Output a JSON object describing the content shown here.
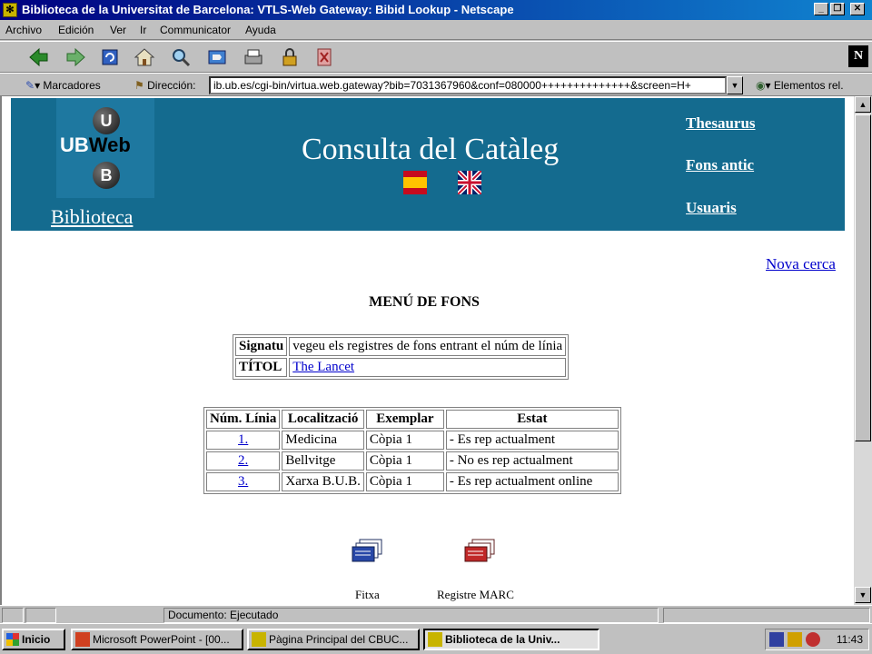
{
  "window": {
    "title": "Biblioteca de la Universitat de Barcelona: VTLS-Web Gateway: Bibid Lookup - Netscape"
  },
  "menu": [
    "Archivo",
    "Edición",
    "Ver",
    "Ir",
    "Communicator",
    "Ayuda"
  ],
  "location_bar": {
    "bookmarks_label": "Marcadores",
    "address_label": "Dirección:",
    "url": "ib.ub.es/cgi-bin/virtua.web.gateway?bib=7031367960&conf=080000++++++++++++++&screen=H+",
    "related_label": "Elementos rel."
  },
  "banner": {
    "logo_u": "U",
    "logo_word_ub": "UB",
    "logo_word_web": "Web",
    "logo_b": "B",
    "biblioteca": "Biblioteca",
    "title": "Consulta del Catàleg",
    "links": [
      "Thesaurus",
      "Fons antic",
      "Usuaris"
    ]
  },
  "nova_cerca": "Nova cerca",
  "heading": "MENÚ DE FONS",
  "info_table": {
    "rows": [
      {
        "label": "Signatu",
        "value": "vegeu els registres de fons entrant el núm de línia"
      },
      {
        "label": "TÍTOL",
        "value": "The Lancet"
      }
    ]
  },
  "holdings_table": {
    "headers": [
      "Núm. Línia",
      "Localització",
      "Exemplar",
      "Estat"
    ],
    "rows": [
      {
        "line": "1.",
        "location": "Medicina",
        "copy": "Còpia 1",
        "status": "- Es rep actualment"
      },
      {
        "line": "2.",
        "location": "Bellvitge",
        "copy": "Còpia 1",
        "status": "- No es rep actualment"
      },
      {
        "line": "3.",
        "location": "Xarxa B.U.B.",
        "copy": "Còpia 1",
        "status": "- Es rep actualment online"
      }
    ]
  },
  "actions": {
    "fitxa": "Fitxa",
    "marc": "Registre MARC"
  },
  "statusbar": {
    "text": "Documento: Ejecutado"
  },
  "taskbar": {
    "start": "Inicio",
    "tasks": [
      "Microsoft PowerPoint - [00...",
      "Pàgina Principal del CBUC...",
      "Biblioteca de la Univ..."
    ],
    "clock": "11:43"
  },
  "colors": {
    "banner": "#146b8f",
    "link": "#0000cc",
    "titlebar": "#000080"
  }
}
